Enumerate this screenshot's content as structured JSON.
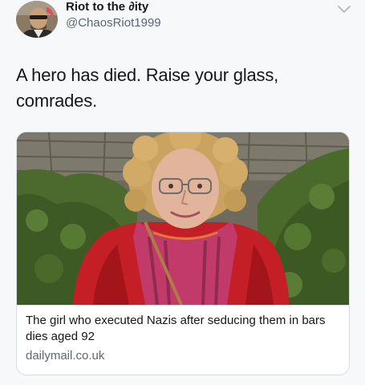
{
  "author": {
    "display_name": "Riot to the ∂ity",
    "handle": "@ChaosRiot1999",
    "avatar_icon": "avatar-photo"
  },
  "menu_icon": "chevron-down-icon",
  "tweet": {
    "text": "A hero has died. Raise your glass, comrades."
  },
  "link_card": {
    "image_icon": "article-photo",
    "title": "The girl who executed Nazis after seducing them in bars dies aged 92",
    "domain": "dailymail.co.uk"
  },
  "colors": {
    "background": "#f7f8f9",
    "text": "#14171a",
    "secondary_text": "#5b6670",
    "border": "#d6dde3"
  }
}
